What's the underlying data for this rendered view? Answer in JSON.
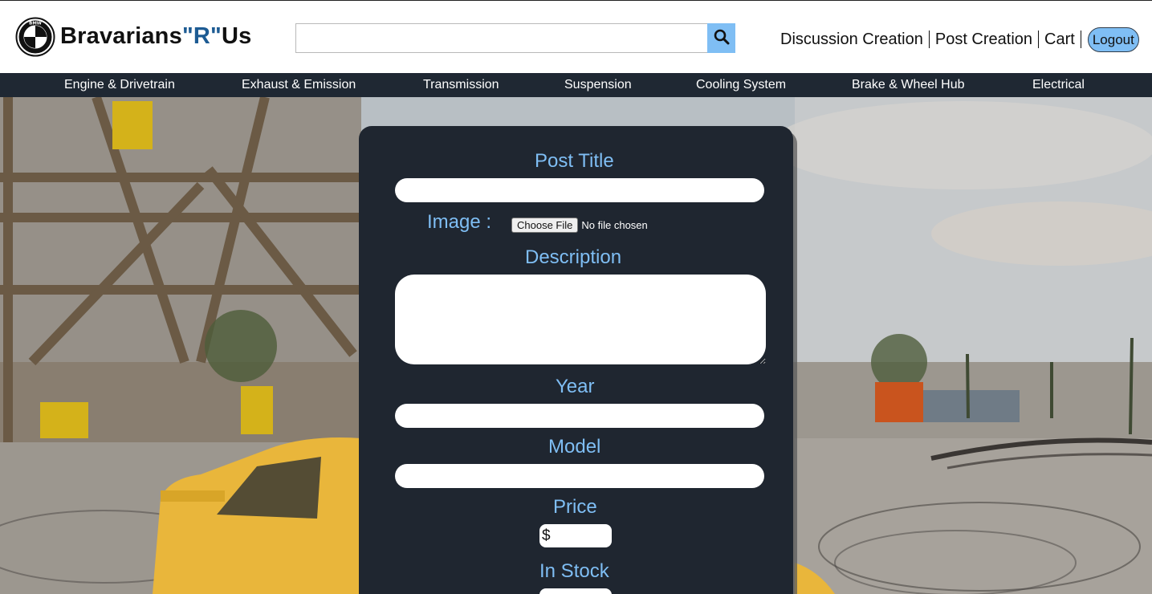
{
  "header": {
    "brand_prefix": "Bravarians",
    "brand_accent": "\"R\"",
    "brand_suffix": "Us",
    "logo_ring_text": "BMW",
    "search": {
      "value": "",
      "placeholder": ""
    },
    "nav": [
      {
        "label": "Discussion Creation"
      },
      {
        "label": "Post Creation"
      },
      {
        "label": "Cart"
      }
    ],
    "logout_label": "Logout"
  },
  "categories": [
    {
      "label": "Engine & Drivetrain"
    },
    {
      "label": "Exhaust & Emission"
    },
    {
      "label": "Transmission"
    },
    {
      "label": "Suspension"
    },
    {
      "label": "Cooling System"
    },
    {
      "label": "Brake & Wheel Hub"
    },
    {
      "label": "Electrical"
    }
  ],
  "form": {
    "post_title_label": "Post Title",
    "post_title_value": "",
    "image_label": "Image :",
    "file_button_label": "Choose File",
    "file_status": "No file chosen",
    "description_label": "Description",
    "description_value": "",
    "year_label": "Year",
    "year_value": "",
    "model_label": "Model",
    "model_value": "",
    "price_label": "Price",
    "price_symbol": "$",
    "price_value": "",
    "in_stock_label": "In Stock",
    "in_stock_value": ""
  },
  "colors": {
    "accent_blue": "#7fbef4",
    "brand_accent": "#1d5b93",
    "nav_bar": "#1f2833",
    "panel": "#1f2630"
  },
  "icons": {
    "search": "search-icon",
    "logo": "bmw-logo-icon"
  }
}
